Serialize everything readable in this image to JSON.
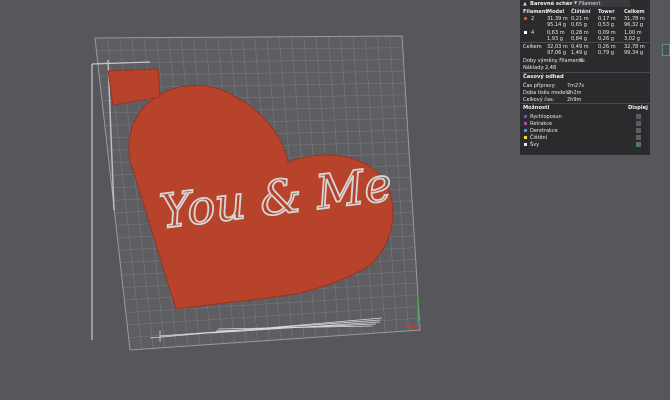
{
  "panel": {
    "title": "Barevné schéma",
    "title_value": "Filament",
    "headers": [
      "Filament",
      "Model",
      "Čištění",
      "Tower",
      "Celkem"
    ],
    "rows": [
      {
        "swatch": "#d7552f",
        "id": "2",
        "model": [
          "31,39 m",
          "95,14 g"
        ],
        "cleaning": [
          "0,21 m",
          "0,65 g"
        ],
        "tower": [
          "0,17 m",
          "0,53 g"
        ],
        "total": [
          "31,78 m",
          "96,32 g"
        ]
      },
      {
        "swatch": "#ffffff",
        "id": "4",
        "model": [
          "0,63 m",
          "1,93 g"
        ],
        "cleaning": [
          "0,28 m",
          "0,84 g"
        ],
        "tower": [
          "0,09 m",
          "0,26 g"
        ],
        "total": [
          "1,00 m",
          "3,02 g"
        ]
      }
    ],
    "total_row": {
      "label": "Celkem",
      "model": [
        "32,03 m",
        "97,06 g"
      ],
      "cleaning": [
        "0,49 m",
        "1,49 g"
      ],
      "tower": [
        "0,26 m",
        "0,79 g"
      ],
      "total": [
        "32,78 m",
        "99,34 g"
      ]
    },
    "changes_label": "Doby výměny Filamentu:",
    "changes_value": "6",
    "cost_label": "Náklady:",
    "cost_value": "2,48",
    "time_title": "Časový odhad",
    "time_rows": [
      {
        "label": "Čas přípravy:",
        "value": "7m27s"
      },
      {
        "label": "Doba tisku modelu:",
        "value": "2h2m"
      },
      {
        "label": "Celkový čas:",
        "value": "2h9m"
      }
    ],
    "options_title": "Možnosti",
    "options_display": "Displej",
    "options": [
      {
        "label": "Rychloposun",
        "color": "#5a5ed8"
      },
      {
        "label": "Retrakce",
        "color": "#b044b0"
      },
      {
        "label": "Deretrakce",
        "color": "#40a0d8"
      },
      {
        "label": "Čištění",
        "color": "#e8e03a"
      },
      {
        "label": "Švy",
        "color": "#e8e8e8"
      }
    ]
  },
  "model": {
    "text": "You & Me",
    "color": "#b8432b",
    "text_color": "#d6d6d6"
  },
  "plate": {
    "color": "#5d5d62",
    "grid_color": "#8a8a8f"
  }
}
